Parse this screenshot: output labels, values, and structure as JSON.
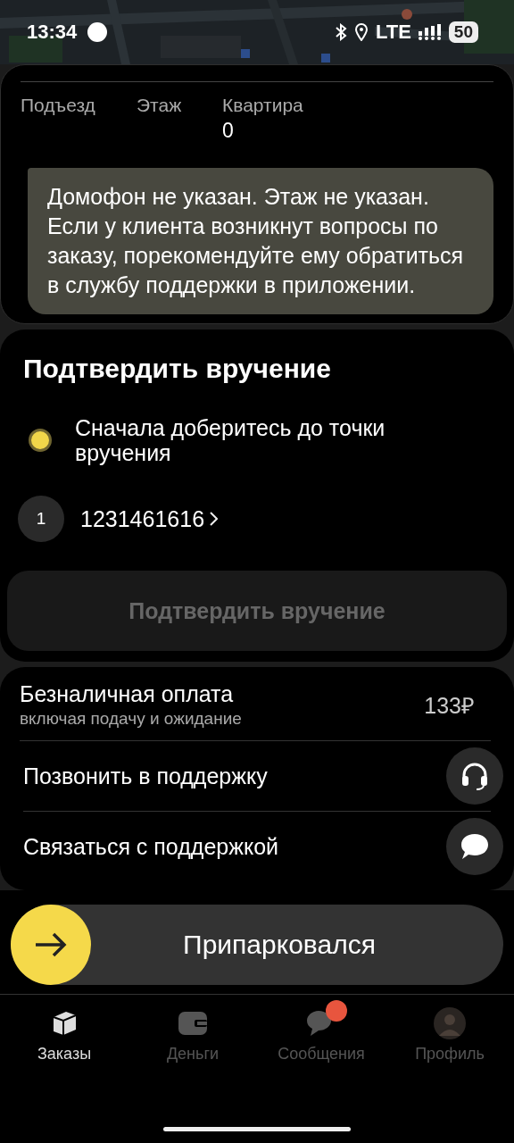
{
  "status_bar": {
    "time": "13:34",
    "network": "LTE",
    "battery": "50"
  },
  "address": {
    "fields": [
      {
        "label": "Подъезд"
      },
      {
        "label": "Этаж"
      },
      {
        "label": "Квартира",
        "value": "0"
      }
    ],
    "note": "Домофон не указан. Этаж не указан. Если у клиента возникнут вопросы по заказу, порекомендуйте ему обратиться в службу поддержки в приложении."
  },
  "handover": {
    "title": "Подтвердить вручение",
    "status": "Сначала доберитесь до точки вручения",
    "items": [
      {
        "index": "1",
        "code": "1231461616"
      }
    ],
    "button": {
      "label": "Подтвердить вручение",
      "disabled": true
    }
  },
  "payment": {
    "title": "Безналичная оплата",
    "subtitle": "включая подачу и ожидание",
    "amount": "133₽"
  },
  "support": [
    {
      "label": "Позвонить в поддержку",
      "kind": "call"
    },
    {
      "label": "Связаться с поддержкой",
      "kind": "chat"
    }
  ],
  "slide_button": {
    "label": "Припарковался"
  },
  "tabs": [
    {
      "label": "Заказы",
      "kind": "orders",
      "selected": true,
      "badge": false
    },
    {
      "label": "Деньги",
      "kind": "money",
      "selected": false,
      "badge": false
    },
    {
      "label": "Сообщения",
      "kind": "messages",
      "selected": false,
      "badge": true
    },
    {
      "label": "Профиль",
      "kind": "profile",
      "selected": false,
      "badge": false
    }
  ]
}
